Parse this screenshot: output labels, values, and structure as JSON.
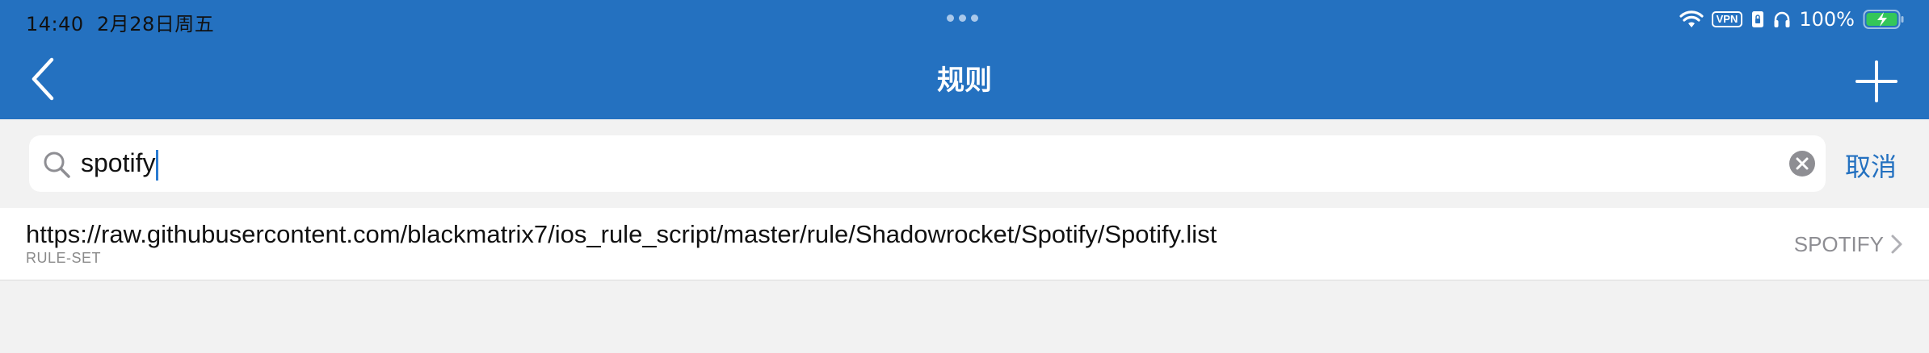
{
  "status_bar": {
    "time": "14:40",
    "date": "2月28日周五",
    "vpn": "VPN",
    "battery": "100%"
  },
  "nav": {
    "title": "规则",
    "back_icon": "chevron-left-icon",
    "add_icon": "plus-icon"
  },
  "search": {
    "value": "spotify",
    "cancel_label": "取消",
    "search_icon": "search-icon",
    "clear_icon": "clear-icon"
  },
  "rules": [
    {
      "url": "https://raw.githubusercontent.com/blackmatrix7/ios_rule_script/master/rule/Shadowrocket/Spotify/Spotify.list",
      "type": "RULE-SET",
      "policy": "SPOTIFY"
    }
  ],
  "colors": {
    "accent": "#2471c0",
    "background": "#f2f2f2",
    "battery": "#34c759"
  }
}
